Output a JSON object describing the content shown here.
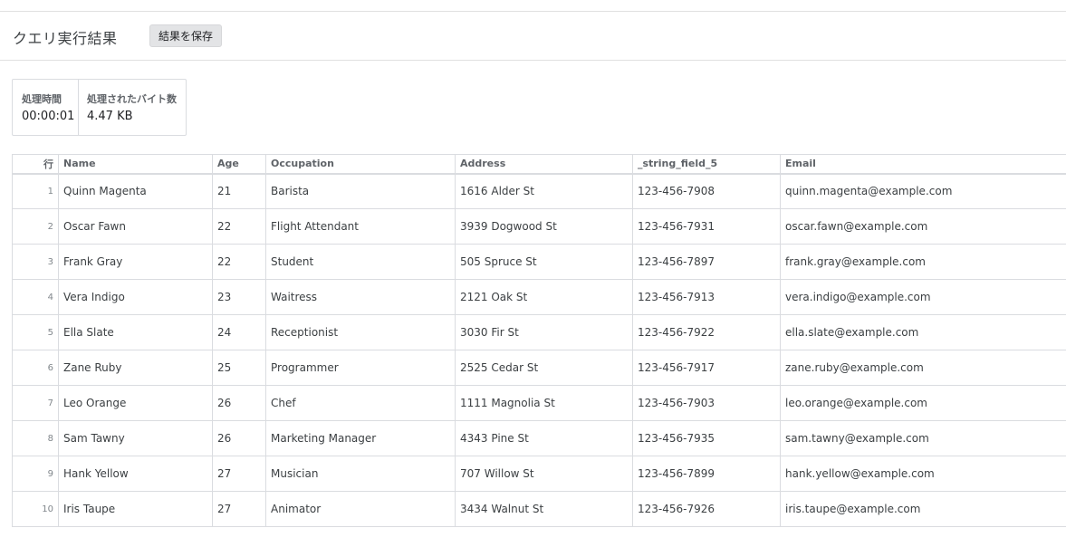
{
  "header": {
    "title": "クエリ実行結果",
    "save_label": "結果を保存"
  },
  "stats": {
    "elapsed": {
      "label": "処理時間",
      "value": "00:00:01"
    },
    "bytes": {
      "label": "処理されたバイト数",
      "value": "4.47 KB"
    }
  },
  "table": {
    "columns": [
      "行",
      "Name",
      "Age",
      "Occupation",
      "Address",
      "_string_field_5",
      "Email"
    ],
    "rows": [
      {
        "n": "1",
        "name": "Quinn Magenta",
        "age": "21",
        "occupation": "Barista",
        "address": "1616 Alder St",
        "phone": "123-456-7908",
        "email": "quinn.magenta@example.com"
      },
      {
        "n": "2",
        "name": "Oscar Fawn",
        "age": "22",
        "occupation": "Flight Attendant",
        "address": "3939 Dogwood St",
        "phone": "123-456-7931",
        "email": "oscar.fawn@example.com"
      },
      {
        "n": "3",
        "name": "Frank Gray",
        "age": "22",
        "occupation": "Student",
        "address": "505 Spruce St",
        "phone": "123-456-7897",
        "email": "frank.gray@example.com"
      },
      {
        "n": "4",
        "name": "Vera Indigo",
        "age": "23",
        "occupation": "Waitress",
        "address": "2121 Oak St",
        "phone": "123-456-7913",
        "email": "vera.indigo@example.com"
      },
      {
        "n": "5",
        "name": "Ella Slate",
        "age": "24",
        "occupation": "Receptionist",
        "address": "3030 Fir St",
        "phone": "123-456-7922",
        "email": "ella.slate@example.com"
      },
      {
        "n": "6",
        "name": "Zane Ruby",
        "age": "25",
        "occupation": "Programmer",
        "address": "2525 Cedar St",
        "phone": "123-456-7917",
        "email": "zane.ruby@example.com"
      },
      {
        "n": "7",
        "name": "Leo Orange",
        "age": "26",
        "occupation": "Chef",
        "address": "1111 Magnolia St",
        "phone": "123-456-7903",
        "email": "leo.orange@example.com"
      },
      {
        "n": "8",
        "name": "Sam Tawny",
        "age": "26",
        "occupation": "Marketing Manager",
        "address": "4343 Pine St",
        "phone": "123-456-7935",
        "email": "sam.tawny@example.com"
      },
      {
        "n": "9",
        "name": "Hank Yellow",
        "age": "27",
        "occupation": "Musician",
        "address": "707 Willow St",
        "phone": "123-456-7899",
        "email": "hank.yellow@example.com"
      },
      {
        "n": "10",
        "name": "Iris Taupe",
        "age": "27",
        "occupation": "Animator",
        "address": "3434 Walnut St",
        "phone": "123-456-7926",
        "email": "iris.taupe@example.com"
      }
    ]
  }
}
